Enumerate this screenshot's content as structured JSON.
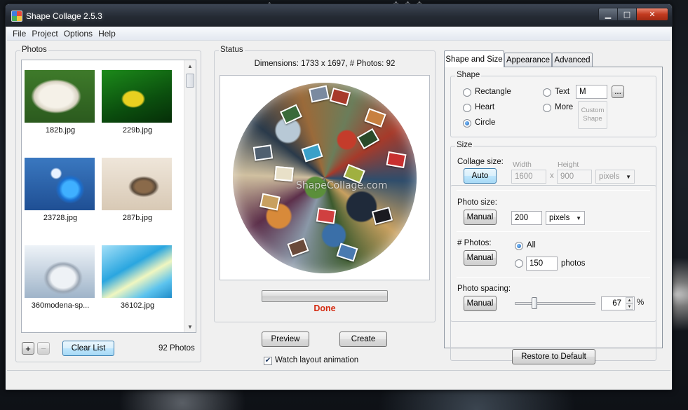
{
  "window": {
    "title": "Shape Collage 2.5.3"
  },
  "menu": [
    "File",
    "Project",
    "Options",
    "Help"
  ],
  "photos_panel": {
    "title": "Photos",
    "photos": [
      {
        "name": "182b.jpg"
      },
      {
        "name": "229b.jpg"
      },
      {
        "name": "23728.jpg"
      },
      {
        "name": "287b.jpg"
      },
      {
        "name": "360modena-sp..."
      },
      {
        "name": "36102.jpg"
      }
    ],
    "add_label": "+",
    "remove_label": "−",
    "clear_label": "Clear List",
    "count_text": "92 Photos"
  },
  "status_panel": {
    "title": "Status",
    "dimensions_text": "Dimensions: 1733 x 1697, # Photos: 92",
    "watermark": "ShapeCollage.com",
    "done_text": "Done",
    "preview_label": "Preview",
    "create_label": "Create",
    "watch_label": "Watch layout animation",
    "watch_checked": true
  },
  "tabs": [
    "Shape and Size",
    "Appearance",
    "Advanced"
  ],
  "shape": {
    "title": "Shape",
    "options": [
      "Rectangle",
      "Heart",
      "Circle",
      "Text",
      "More"
    ],
    "selected": "Circle",
    "text_value": "M",
    "browse_label": "...",
    "custom_shape_label": "Custom Shape"
  },
  "size": {
    "title": "Size",
    "collage_size_label": "Collage size:",
    "collage_btn": "Auto",
    "width_label": "Width",
    "height_label": "Height",
    "width_value": "1600",
    "height_value": "900",
    "x_label": "x",
    "collage_unit": "pixels",
    "photo_size_label": "Photo size:",
    "photo_size_btn": "Manual",
    "photo_size_value": "200",
    "photo_size_unit": "pixels",
    "num_photos_label": "# Photos:",
    "num_photos_btn": "Manual",
    "all_label": "All",
    "photos_value": "150",
    "photos_unit": "photos",
    "spacing_label": "Photo spacing:",
    "spacing_btn": "Manual",
    "spacing_value": "67",
    "spacing_unit": "%"
  },
  "restore_label": "Restore to Default",
  "colors": {
    "accent": "#3c7fb1",
    "done": "#d42a10"
  }
}
